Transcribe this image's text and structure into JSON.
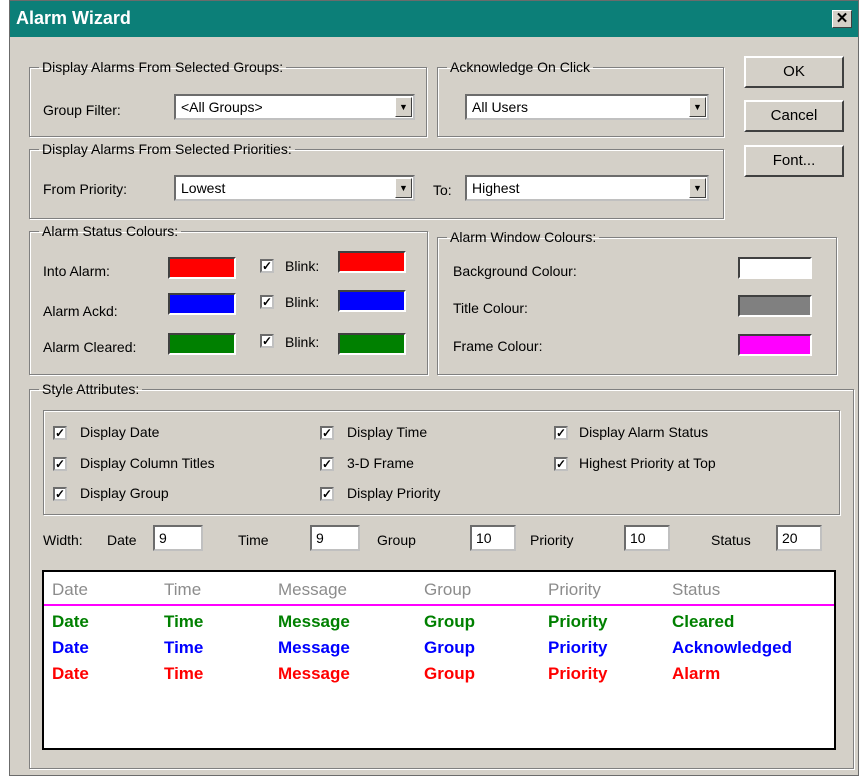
{
  "window": {
    "title": "Alarm Wizard"
  },
  "buttons": {
    "ok": "OK",
    "cancel": "Cancel",
    "font": "Font..."
  },
  "groups": {
    "legend": "Display Alarms From Selected Groups:",
    "filter_label": "Group Filter:",
    "filter_value": "<All Groups>"
  },
  "acknowledge": {
    "legend": "Acknowledge On Click",
    "value": "All Users"
  },
  "priorities": {
    "legend": "Display Alarms From Selected Priorities:",
    "from_label": "From Priority:",
    "from_value": "Lowest",
    "to_label": "To:",
    "to_value": "Highest"
  },
  "status_colours": {
    "legend": "Alarm Status Colours:",
    "blink_label": "Blink:",
    "rows": [
      {
        "label": "Into Alarm:",
        "color": "#ff0000",
        "blink_checked": true,
        "blink_color": "#ff0000"
      },
      {
        "label": "Alarm Ackd:",
        "color": "#0000ff",
        "blink_checked": true,
        "blink_color": "#0000ff"
      },
      {
        "label": "Alarm Cleared:",
        "color": "#008000",
        "blink_checked": true,
        "blink_color": "#008000"
      }
    ]
  },
  "window_colours": {
    "legend": "Alarm Window Colours:",
    "rows": [
      {
        "label": "Background Colour:",
        "color": "#ffffff"
      },
      {
        "label": "Title Colour:",
        "color": "#808080"
      },
      {
        "label": "Frame Colour:",
        "color": "#ff00ff"
      }
    ]
  },
  "style": {
    "legend": "Style Attributes:",
    "checkboxes": [
      {
        "label": "Display Date",
        "checked": true
      },
      {
        "label": "Display Time",
        "checked": true
      },
      {
        "label": "Display Alarm Status",
        "checked": true
      },
      {
        "label": "Display Column Titles",
        "checked": true
      },
      {
        "label": "3-D Frame",
        "checked": true
      },
      {
        "label": "Highest Priority at Top",
        "checked": true
      },
      {
        "label": "Display Group",
        "checked": true
      },
      {
        "label": "Display Priority",
        "checked": true
      }
    ],
    "width_label": "Width:",
    "widths": [
      {
        "label": "Date",
        "value": "9"
      },
      {
        "label": "Time",
        "value": "9"
      },
      {
        "label": "Group",
        "value": "10"
      },
      {
        "label": "Priority",
        "value": "10"
      },
      {
        "label": "Status",
        "value": "20"
      }
    ]
  },
  "preview": {
    "headers": [
      "Date",
      "Time",
      "Message",
      "Group",
      "Priority",
      "Status"
    ],
    "rows": [
      {
        "color": "#008000",
        "cells": [
          "Date",
          "Time",
          "Message",
          "Group",
          "Priority",
          "Cleared"
        ]
      },
      {
        "color": "#0000ff",
        "cells": [
          "Date",
          "Time",
          "Message",
          "Group",
          "Priority",
          "Acknowledged"
        ]
      },
      {
        "color": "#ff0000",
        "cells": [
          "Date",
          "Time",
          "Message",
          "Group",
          "Priority",
          "Alarm"
        ]
      }
    ],
    "title_line_color": "#ff00ff"
  },
  "icons": {
    "close": "close-icon",
    "dropdown": "dropdown-arrow-icon",
    "check": "check-icon"
  }
}
